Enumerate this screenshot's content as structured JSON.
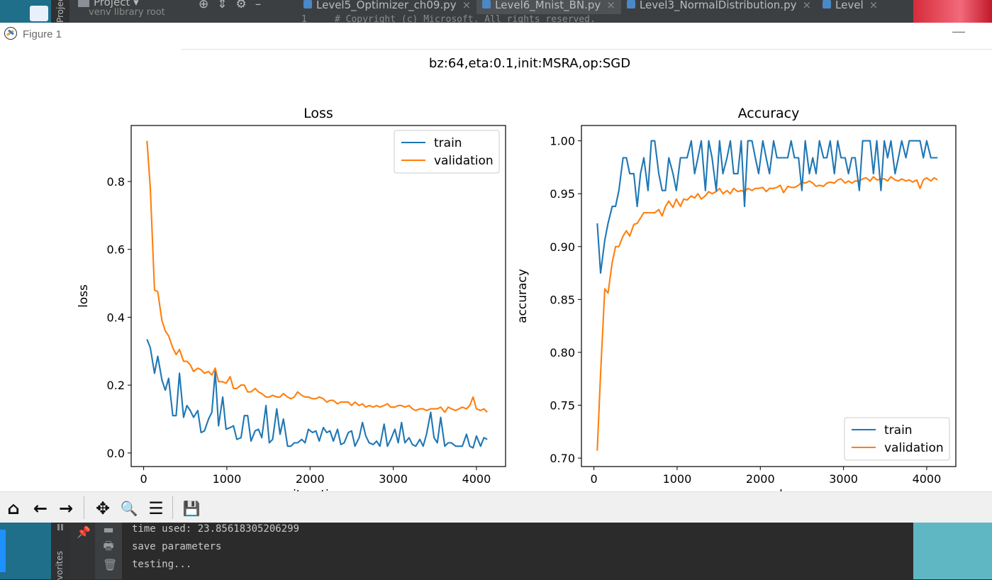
{
  "ide": {
    "project_label": "Project",
    "venv_label": "venv  library root",
    "tabs": [
      {
        "label": "Level5_Optimizer_ch09.py",
        "active": false
      },
      {
        "label": "Level6_Mnist_BN.py",
        "active": true
      },
      {
        "label": "Level3_NormalDistribution.py",
        "active": false
      },
      {
        "label": "Level",
        "active": false
      }
    ],
    "code_line_number": "1",
    "code_text": "# Copyright (c) Microsoft. All rights reserved.",
    "side_label": "Project",
    "favorites_label": "vorites"
  },
  "figure": {
    "window_title": "Figure 1",
    "minimize_glyph": "—",
    "suptitle": "bz:64,eta:0.1,init:MSRA,op:SGD"
  },
  "toolbar": {
    "home_icon": "⌂",
    "back_icon": "←",
    "forward_icon": "→",
    "pan_icon": "✥",
    "zoom_icon": "🔍",
    "configure_icon": "☰",
    "save_icon": "💾"
  },
  "console": {
    "lines": [
      "time used: 23.85618305206299",
      "save parameters",
      "testing..."
    ]
  },
  "colors": {
    "validation": "#ff7f0e",
    "train": "#1f77b4"
  },
  "chart_data": [
    {
      "type": "line",
      "title": "Loss",
      "xlabel": "iteration",
      "ylabel": "loss",
      "xlim": [
        -150,
        4350
      ],
      "ylim": [
        -0.04,
        0.965
      ],
      "xticks": [
        0,
        1000,
        2000,
        3000,
        4000
      ],
      "yticks": [
        0.0,
        0.2,
        0.4,
        0.6,
        0.8
      ],
      "ytick_labels": [
        "0.0",
        "0.2",
        "0.4",
        "0.6",
        "0.8"
      ],
      "legend_position": "upper right",
      "series": [
        {
          "name": "validation",
          "color": "#ff7f0e",
          "x": [
            40,
            80,
            130,
            170,
            220,
            260,
            300,
            350,
            390,
            430,
            480,
            520,
            560,
            600,
            650,
            690,
            730,
            780,
            820,
            860,
            900,
            950,
            990,
            1040,
            1080,
            1120,
            1170,
            1210,
            1250,
            1290,
            1340,
            1380,
            1420,
            1470,
            1510,
            1550,
            1600,
            1640,
            1680,
            1730,
            1770,
            1810,
            1850,
            1900,
            1940,
            1980,
            2030,
            2070,
            2110,
            2160,
            2200,
            2240,
            2280,
            2330,
            2370,
            2410,
            2460,
            2500,
            2540,
            2590,
            2630,
            2670,
            2710,
            2760,
            2800,
            2840,
            2890,
            2930,
            2970,
            3020,
            3060,
            3100,
            3140,
            3190,
            3230,
            3270,
            3320,
            3360,
            3400,
            3450,
            3490,
            3530,
            3570,
            3620,
            3660,
            3700,
            3750,
            3790,
            3830,
            3880,
            3920,
            3960,
            4000,
            4050,
            4090,
            4130
          ],
          "y": [
            0.92,
            0.78,
            0.48,
            0.475,
            0.39,
            0.36,
            0.345,
            0.31,
            0.29,
            0.305,
            0.27,
            0.27,
            0.26,
            0.24,
            0.25,
            0.245,
            0.235,
            0.24,
            0.23,
            0.25,
            0.21,
            0.21,
            0.205,
            0.225,
            0.19,
            0.19,
            0.2,
            0.2,
            0.18,
            0.18,
            0.19,
            0.18,
            0.175,
            0.165,
            0.165,
            0.17,
            0.165,
            0.165,
            0.175,
            0.165,
            0.16,
            0.165,
            0.18,
            0.17,
            0.165,
            0.165,
            0.16,
            0.16,
            0.165,
            0.16,
            0.15,
            0.155,
            0.155,
            0.145,
            0.15,
            0.15,
            0.15,
            0.14,
            0.15,
            0.14,
            0.145,
            0.135,
            0.14,
            0.135,
            0.14,
            0.135,
            0.14,
            0.145,
            0.135,
            0.135,
            0.14,
            0.14,
            0.135,
            0.14,
            0.13,
            0.125,
            0.13,
            0.13,
            0.125,
            0.13,
            0.13,
            0.13,
            0.135,
            0.12,
            0.135,
            0.13,
            0.125,
            0.13,
            0.135,
            0.13,
            0.14,
            0.165,
            0.13,
            0.125,
            0.13,
            0.12
          ]
        },
        {
          "name": "train",
          "color": "#1f77b4",
          "x": [
            40,
            80,
            130,
            170,
            220,
            260,
            300,
            350,
            390,
            430,
            480,
            520,
            560,
            600,
            650,
            690,
            730,
            780,
            820,
            860,
            900,
            950,
            990,
            1040,
            1080,
            1120,
            1170,
            1210,
            1250,
            1290,
            1340,
            1380,
            1420,
            1470,
            1510,
            1550,
            1600,
            1640,
            1680,
            1730,
            1770,
            1810,
            1850,
            1900,
            1940,
            1980,
            2030,
            2070,
            2110,
            2160,
            2200,
            2240,
            2280,
            2330,
            2370,
            2410,
            2460,
            2500,
            2540,
            2590,
            2630,
            2670,
            2710,
            2760,
            2800,
            2840,
            2890,
            2930,
            2970,
            3020,
            3060,
            3100,
            3140,
            3190,
            3230,
            3270,
            3320,
            3360,
            3400,
            3450,
            3490,
            3530,
            3570,
            3620,
            3660,
            3700,
            3750,
            3790,
            3830,
            3880,
            3920,
            3960,
            4000,
            4050,
            4090,
            4130
          ],
          "y": [
            0.335,
            0.31,
            0.235,
            0.285,
            0.215,
            0.185,
            0.22,
            0.11,
            0.11,
            0.235,
            0.105,
            0.14,
            0.125,
            0.105,
            0.125,
            0.06,
            0.065,
            0.1,
            0.12,
            0.24,
            0.08,
            0.165,
            0.07,
            0.075,
            0.08,
            0.04,
            0.045,
            0.11,
            0.11,
            0.035,
            0.065,
            0.07,
            0.045,
            0.14,
            0.03,
            0.04,
            0.13,
            0.055,
            0.1,
            0.02,
            0.02,
            0.03,
            0.03,
            0.04,
            0.03,
            0.07,
            0.06,
            0.065,
            0.035,
            0.075,
            0.06,
            0.065,
            0.035,
            0.07,
            0.025,
            0.03,
            0.06,
            0.065,
            0.02,
            0.045,
            0.09,
            0.05,
            0.03,
            0.025,
            0.035,
            0.02,
            0.085,
            0.02,
            0.04,
            0.07,
            0.03,
            0.09,
            0.03,
            0.045,
            0.025,
            0.02,
            0.04,
            0.02,
            0.055,
            0.12,
            0.045,
            0.03,
            0.105,
            0.02,
            0.03,
            0.03,
            0.02,
            0.02,
            0.02,
            0.055,
            0.02,
            0.015,
            0.05,
            0.02,
            0.045,
            0.04
          ]
        }
      ]
    },
    {
      "type": "line",
      "title": "Accuracy",
      "xlabel": "epoch",
      "ylabel": "accuracy",
      "xlim": [
        -150,
        4350
      ],
      "ylim": [
        0.692,
        1.0145
      ],
      "xticks": [
        0,
        1000,
        2000,
        3000,
        4000
      ],
      "yticks": [
        0.7,
        0.75,
        0.8,
        0.85,
        0.9,
        0.95,
        1.0
      ],
      "ytick_labels": [
        "0.70",
        "0.75",
        "0.80",
        "0.85",
        "0.90",
        "0.95",
        "1.00"
      ],
      "legend_position": "lower right",
      "series": [
        {
          "name": "validation",
          "color": "#ff7f0e",
          "x": [
            40,
            80,
            130,
            170,
            220,
            260,
            300,
            350,
            390,
            430,
            480,
            520,
            560,
            600,
            650,
            690,
            730,
            780,
            820,
            860,
            900,
            950,
            990,
            1040,
            1080,
            1120,
            1170,
            1210,
            1250,
            1290,
            1340,
            1380,
            1420,
            1470,
            1510,
            1550,
            1600,
            1640,
            1680,
            1730,
            1770,
            1810,
            1850,
            1900,
            1940,
            1980,
            2030,
            2070,
            2110,
            2160,
            2200,
            2240,
            2280,
            2330,
            2370,
            2410,
            2460,
            2500,
            2540,
            2590,
            2630,
            2670,
            2710,
            2760,
            2800,
            2840,
            2890,
            2930,
            2970,
            3020,
            3060,
            3100,
            3140,
            3190,
            3230,
            3270,
            3320,
            3360,
            3400,
            3450,
            3490,
            3530,
            3570,
            3620,
            3660,
            3700,
            3750,
            3790,
            3830,
            3880,
            3920,
            3960,
            4000,
            4050,
            4090,
            4130
          ],
          "y": [
            0.707,
            0.78,
            0.86,
            0.856,
            0.885,
            0.9,
            0.9,
            0.91,
            0.915,
            0.91,
            0.921,
            0.922,
            0.927,
            0.932,
            0.932,
            0.932,
            0.932,
            0.935,
            0.929,
            0.938,
            0.943,
            0.937,
            0.945,
            0.938,
            0.945,
            0.944,
            0.948,
            0.946,
            0.95,
            0.945,
            0.948,
            0.952,
            0.95,
            0.952,
            0.955,
            0.95,
            0.953,
            0.95,
            0.955,
            0.952,
            0.953,
            0.952,
            0.955,
            0.953,
            0.955,
            0.955,
            0.956,
            0.952,
            0.955,
            0.955,
            0.956,
            0.958,
            0.951,
            0.957,
            0.956,
            0.956,
            0.958,
            0.961,
            0.96,
            0.962,
            0.96,
            0.957,
            0.958,
            0.957,
            0.96,
            0.961,
            0.96,
            0.963,
            0.964,
            0.96,
            0.962,
            0.96,
            0.962,
            0.962,
            0.964,
            0.965,
            0.962,
            0.966,
            0.963,
            0.964,
            0.964,
            0.962,
            0.966,
            0.963,
            0.962,
            0.964,
            0.962,
            0.963,
            0.961,
            0.963,
            0.955,
            0.963,
            0.965,
            0.962,
            0.965,
            0.963
          ]
        },
        {
          "name": "train",
          "color": "#1f77b4",
          "x": [
            40,
            80,
            130,
            170,
            220,
            260,
            300,
            350,
            390,
            430,
            480,
            520,
            560,
            600,
            650,
            690,
            730,
            780,
            820,
            860,
            900,
            950,
            990,
            1040,
            1080,
            1120,
            1170,
            1210,
            1250,
            1290,
            1340,
            1380,
            1420,
            1470,
            1510,
            1550,
            1600,
            1640,
            1680,
            1730,
            1770,
            1810,
            1850,
            1900,
            1940,
            1980,
            2030,
            2070,
            2110,
            2160,
            2200,
            2240,
            2280,
            2330,
            2370,
            2410,
            2460,
            2500,
            2540,
            2590,
            2630,
            2670,
            2710,
            2760,
            2800,
            2840,
            2890,
            2930,
            2970,
            3020,
            3060,
            3100,
            3140,
            3190,
            3230,
            3270,
            3320,
            3360,
            3400,
            3450,
            3490,
            3530,
            3570,
            3620,
            3660,
            3700,
            3750,
            3790,
            3830,
            3880,
            3920,
            3960,
            4000,
            4050,
            4090,
            4130
          ],
          "y": [
            0.922,
            0.875,
            0.906,
            0.922,
            0.938,
            0.938,
            0.953,
            0.984,
            0.984,
            0.969,
            0.969,
            0.938,
            0.969,
            0.984,
            0.953,
            1.0,
            1.0,
            0.969,
            0.953,
            0.953,
            0.984,
            0.969,
            0.953,
            0.984,
            0.984,
            0.984,
            1.0,
            0.969,
            0.984,
            1.0,
            0.953,
            1.0,
            0.984,
            0.953,
            1.0,
            0.969,
            0.984,
            1.0,
            0.969,
            0.969,
            1.0,
            0.938,
            1.0,
            1.0,
            0.984,
            0.969,
            1.0,
            0.984,
            0.969,
            1.0,
            0.984,
            0.984,
            0.984,
            0.984,
            1.0,
            0.984,
            0.984,
            0.953,
            1.0,
            0.969,
            0.984,
            0.969,
            1.0,
            0.984,
            0.984,
            1.0,
            0.969,
            1.0,
            0.984,
            0.984,
            0.969,
            0.984,
            0.984,
            0.953,
            1.0,
            1.0,
            1.0,
            0.969,
            1.0,
            0.953,
            1.0,
            0.984,
            1.0,
            0.969,
            0.984,
            1.0,
            0.984,
            1.0,
            1.0,
            1.0,
            1.0,
            0.984,
            1.0,
            0.984,
            0.984,
            0.984
          ]
        }
      ]
    }
  ]
}
